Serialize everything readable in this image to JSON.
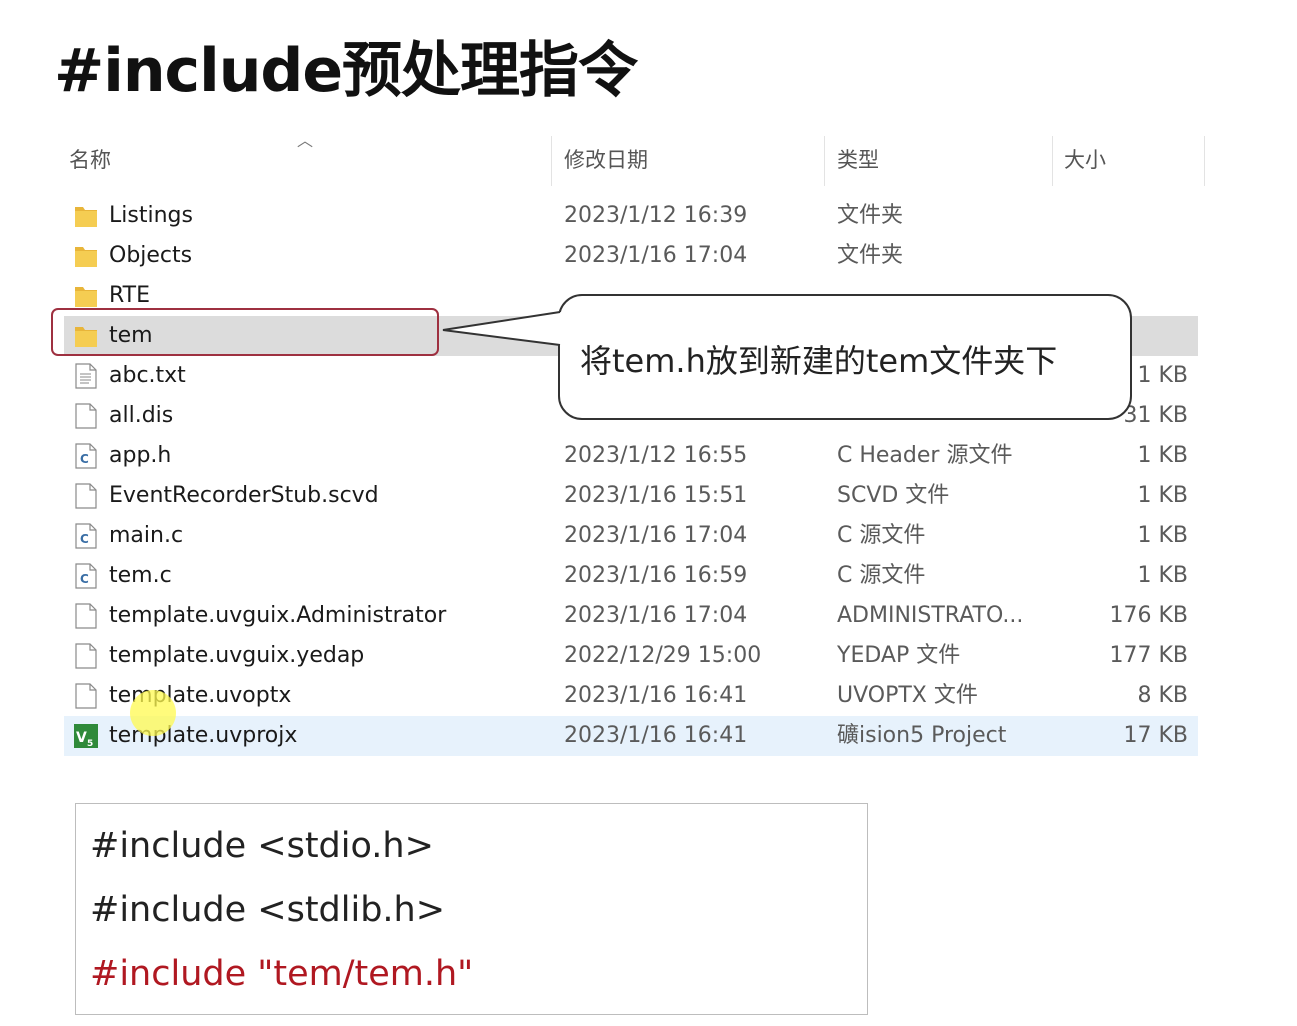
{
  "title": "#include预处理指令",
  "columns": {
    "name": "名称",
    "date": "修改日期",
    "type": "类型",
    "size": "大小"
  },
  "files": [
    {
      "name": "Listings",
      "date": "2023/1/12 16:39",
      "type": "文件夹",
      "size": "",
      "icon": "folder-icon"
    },
    {
      "name": "Objects",
      "date": "2023/1/16 17:04",
      "type": "文件夹",
      "size": "",
      "icon": "folder-icon"
    },
    {
      "name": "RTE",
      "date": "",
      "type": "",
      "size": "",
      "icon": "folder-icon"
    },
    {
      "name": "tem",
      "date": "",
      "type": "",
      "size": "",
      "icon": "folder-icon"
    },
    {
      "name": "abc.txt",
      "date": "",
      "type": "",
      "size": "1 KB",
      "icon": "text-file-icon"
    },
    {
      "name": "all.dis",
      "date": "",
      "type": "",
      "size": "31 KB",
      "icon": "file-icon"
    },
    {
      "name": "app.h",
      "date": "2023/1/12 16:55",
      "type": "C Header 源文件",
      "size": "1 KB",
      "icon": "c-source-icon"
    },
    {
      "name": "EventRecorderStub.scvd",
      "date": "2023/1/16 15:51",
      "type": "SCVD 文件",
      "size": "1 KB",
      "icon": "file-icon"
    },
    {
      "name": "main.c",
      "date": "2023/1/16 17:04",
      "type": "C 源文件",
      "size": "1 KB",
      "icon": "c-source-icon"
    },
    {
      "name": "tem.c",
      "date": "2023/1/16 16:59",
      "type": "C 源文件",
      "size": "1 KB",
      "icon": "c-source-icon"
    },
    {
      "name": "template.uvguix.Administrator",
      "date": "2023/1/16 17:04",
      "type": "ADMINISTRATO...",
      "size": "176 KB",
      "icon": "file-icon"
    },
    {
      "name": "template.uvguix.yedap",
      "date": "2022/12/29 15:00",
      "type": "YEDAP 文件",
      "size": "177 KB",
      "icon": "file-icon"
    },
    {
      "name": "template.uvoptx",
      "date": "2023/1/16 16:41",
      "type": "UVOPTX 文件",
      "size": "8 KB",
      "icon": "file-icon"
    },
    {
      "name": "template.uvprojx",
      "date": "2023/1/16 16:41",
      "type": "礦ision5 Project",
      "size": "17 KB",
      "icon": "keil-project-icon"
    }
  ],
  "callout": "将tem.h放到新建的tem文件夹下",
  "code": [
    {
      "text": "#include <stdio.h>",
      "color": "#222222"
    },
    {
      "text": "#include <stdlib.h>",
      "color": "#222222"
    },
    {
      "text": "#include \"tem/tem.h\"",
      "color": "#b01821"
    }
  ],
  "colors": {
    "highlight_box": "#9e3040",
    "selected_row": "#e7f2fc",
    "hover_row": "#dcdcdc",
    "folder": "#f5cd52"
  }
}
